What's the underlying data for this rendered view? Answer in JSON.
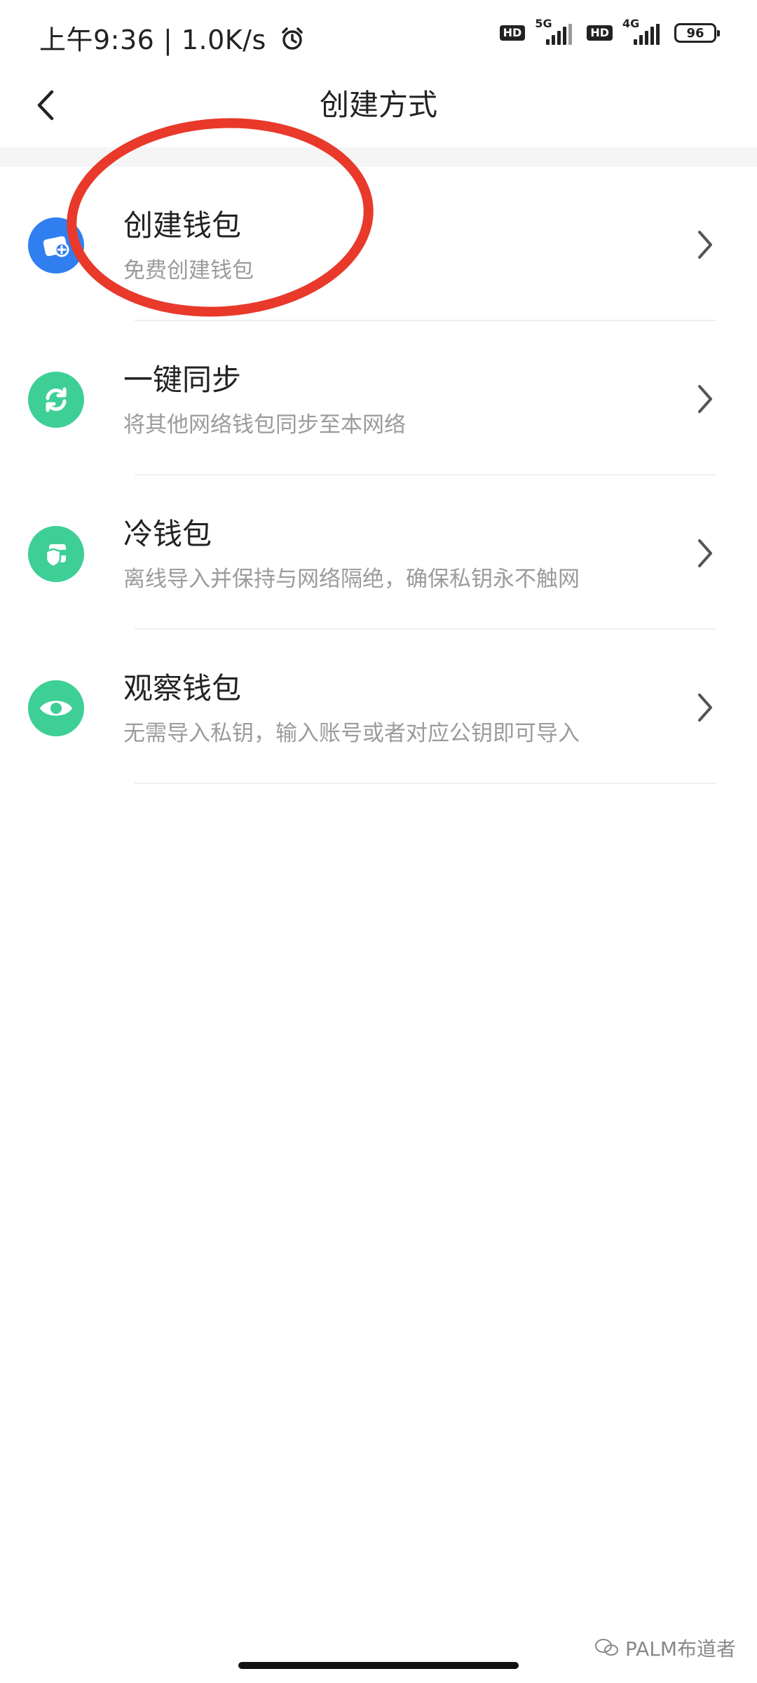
{
  "status_bar": {
    "time": "上午9:36",
    "net_speed": "1.0K/s",
    "sim1_label": "5G",
    "sim2_label": "4G",
    "hd": "HD",
    "battery": "96",
    "icons": [
      "alarm-icon",
      "signal-icon",
      "battery-icon"
    ]
  },
  "header": {
    "title": "创建方式",
    "back_icon": "back-icon"
  },
  "items": [
    {
      "title": "创建钱包",
      "subtitle": "免费创建钱包",
      "icon": "create-wallet-icon",
      "color": "#2f7ff0"
    },
    {
      "title": "一键同步",
      "subtitle": "将其他网络钱包同步至本网络",
      "icon": "sync-icon",
      "color": "#3ecf96"
    },
    {
      "title": "冷钱包",
      "subtitle": "离线导入并保持与网络隔绝，确保私钥永不触网",
      "icon": "cold-wallet-icon",
      "color": "#3ecf96"
    },
    {
      "title": "观察钱包",
      "subtitle": "无需导入私钥，输入账号或者对应公钥即可导入",
      "icon": "eye-icon",
      "color": "#3ecf96"
    }
  ],
  "watermark": {
    "text": "PALM布道者"
  },
  "colors": {
    "accent_blue": "#2f7ff0",
    "accent_green": "#3ecf96",
    "annotation_red": "#e8392b"
  }
}
